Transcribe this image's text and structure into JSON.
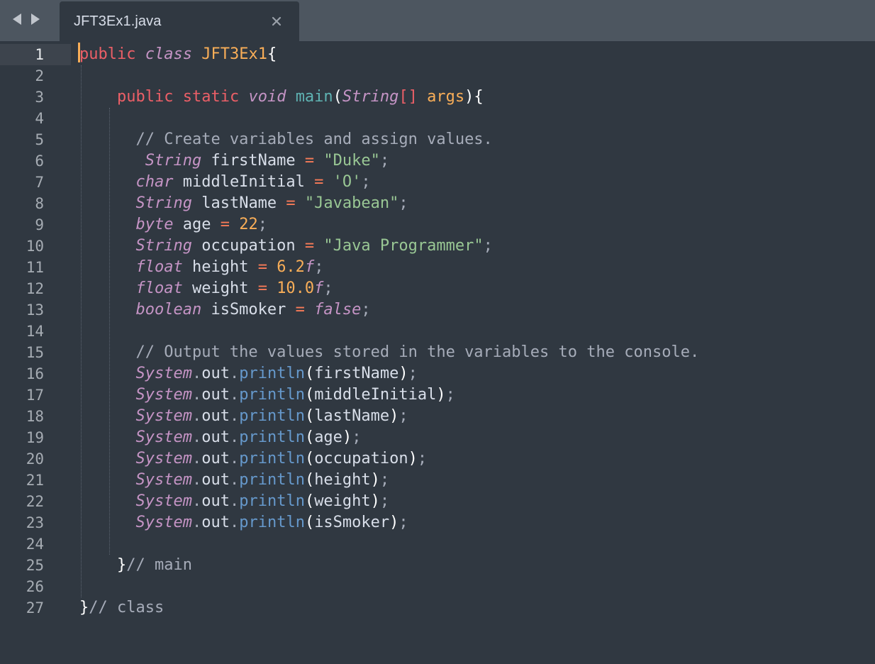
{
  "tab": {
    "title": "JFT3Ex1.java",
    "close_glyph": "×"
  },
  "nav": {
    "back_icon": "triangle-left-icon",
    "forward_icon": "triangle-right-icon"
  },
  "editor": {
    "active_line": 1,
    "line_numbers": [
      "1",
      "2",
      "3",
      "4",
      "5",
      "6",
      "7",
      "8",
      "9",
      "10",
      "11",
      "12",
      "13",
      "14",
      "15",
      "16",
      "17",
      "18",
      "19",
      "20",
      "21",
      "22",
      "23",
      "24",
      "25",
      "26",
      "27"
    ],
    "lines": [
      [
        {
          "t": "public",
          "c": "kw"
        },
        {
          "t": " ",
          "c": "pl"
        },
        {
          "t": "class",
          "c": "it"
        },
        {
          "t": " ",
          "c": "pl"
        },
        {
          "t": "JFT3Ex1",
          "c": "cls"
        },
        {
          "t": "{",
          "c": "brace"
        }
      ],
      [],
      [
        {
          "t": "    ",
          "c": "pl"
        },
        {
          "t": "public",
          "c": "kw"
        },
        {
          "t": " ",
          "c": "pl"
        },
        {
          "t": "static",
          "c": "kw"
        },
        {
          "t": " ",
          "c": "pl"
        },
        {
          "t": "void",
          "c": "it"
        },
        {
          "t": " ",
          "c": "pl"
        },
        {
          "t": "main",
          "c": "fn"
        },
        {
          "t": "(",
          "c": "brace"
        },
        {
          "t": "String",
          "c": "it"
        },
        {
          "t": "[]",
          "c": "kw"
        },
        {
          "t": " ",
          "c": "pl"
        },
        {
          "t": "args",
          "c": "param"
        },
        {
          "t": "){",
          "c": "brace"
        }
      ],
      [],
      [
        {
          "t": "      ",
          "c": "pl"
        },
        {
          "t": "// Create variables and assign values.",
          "c": "cm"
        }
      ],
      [
        {
          "t": "       ",
          "c": "pl"
        },
        {
          "t": "String",
          "c": "it"
        },
        {
          "t": " firstName ",
          "c": "pl"
        },
        {
          "t": "=",
          "c": "op"
        },
        {
          "t": " ",
          "c": "pl"
        },
        {
          "t": "\"Duke\"",
          "c": "str"
        },
        {
          "t": ";",
          "c": "punc"
        }
      ],
      [
        {
          "t": "      ",
          "c": "pl"
        },
        {
          "t": "char",
          "c": "it"
        },
        {
          "t": " middleInitial ",
          "c": "pl"
        },
        {
          "t": "=",
          "c": "op"
        },
        {
          "t": " ",
          "c": "pl"
        },
        {
          "t": "'O'",
          "c": "str"
        },
        {
          "t": ";",
          "c": "punc"
        }
      ],
      [
        {
          "t": "      ",
          "c": "pl"
        },
        {
          "t": "String",
          "c": "it"
        },
        {
          "t": " lastName ",
          "c": "pl"
        },
        {
          "t": "=",
          "c": "op"
        },
        {
          "t": " ",
          "c": "pl"
        },
        {
          "t": "\"Javabean\"",
          "c": "str"
        },
        {
          "t": ";",
          "c": "punc"
        }
      ],
      [
        {
          "t": "      ",
          "c": "pl"
        },
        {
          "t": "byte",
          "c": "it"
        },
        {
          "t": " age ",
          "c": "pl"
        },
        {
          "t": "=",
          "c": "op"
        },
        {
          "t": " ",
          "c": "pl"
        },
        {
          "t": "22",
          "c": "num-lit"
        },
        {
          "t": ";",
          "c": "punc"
        }
      ],
      [
        {
          "t": "      ",
          "c": "pl"
        },
        {
          "t": "String",
          "c": "it"
        },
        {
          "t": " occupation ",
          "c": "pl"
        },
        {
          "t": "=",
          "c": "op"
        },
        {
          "t": " ",
          "c": "pl"
        },
        {
          "t": "\"Java Programmer\"",
          "c": "str"
        },
        {
          "t": ";",
          "c": "punc"
        }
      ],
      [
        {
          "t": "      ",
          "c": "pl"
        },
        {
          "t": "float",
          "c": "it"
        },
        {
          "t": " height ",
          "c": "pl"
        },
        {
          "t": "=",
          "c": "op"
        },
        {
          "t": " ",
          "c": "pl"
        },
        {
          "t": "6.2",
          "c": "num-lit"
        },
        {
          "t": "f",
          "c": "it"
        },
        {
          "t": ";",
          "c": "punc"
        }
      ],
      [
        {
          "t": "      ",
          "c": "pl"
        },
        {
          "t": "float",
          "c": "it"
        },
        {
          "t": " weight ",
          "c": "pl"
        },
        {
          "t": "=",
          "c": "op"
        },
        {
          "t": " ",
          "c": "pl"
        },
        {
          "t": "10.0",
          "c": "num-lit"
        },
        {
          "t": "f",
          "c": "it"
        },
        {
          "t": ";",
          "c": "punc"
        }
      ],
      [
        {
          "t": "      ",
          "c": "pl"
        },
        {
          "t": "boolean",
          "c": "it"
        },
        {
          "t": " isSmoker ",
          "c": "pl"
        },
        {
          "t": "=",
          "c": "op"
        },
        {
          "t": " ",
          "c": "pl"
        },
        {
          "t": "false",
          "c": "kw it"
        },
        {
          "t": ";",
          "c": "punc"
        }
      ],
      [],
      [
        {
          "t": "      ",
          "c": "pl"
        },
        {
          "t": "// Output the values stored in the variables to the console.",
          "c": "cm"
        }
      ],
      [
        {
          "t": "      ",
          "c": "pl"
        },
        {
          "t": "System",
          "c": "it"
        },
        {
          "t": ".",
          "c": "punc"
        },
        {
          "t": "out",
          "c": "pl"
        },
        {
          "t": ".",
          "c": "punc"
        },
        {
          "t": "println",
          "c": "meth"
        },
        {
          "t": "(",
          "c": "brace"
        },
        {
          "t": "firstName",
          "c": "pl"
        },
        {
          "t": ")",
          "c": "brace"
        },
        {
          "t": ";",
          "c": "punc"
        }
      ],
      [
        {
          "t": "      ",
          "c": "pl"
        },
        {
          "t": "System",
          "c": "it"
        },
        {
          "t": ".",
          "c": "punc"
        },
        {
          "t": "out",
          "c": "pl"
        },
        {
          "t": ".",
          "c": "punc"
        },
        {
          "t": "println",
          "c": "meth"
        },
        {
          "t": "(",
          "c": "brace"
        },
        {
          "t": "middleInitial",
          "c": "pl"
        },
        {
          "t": ")",
          "c": "brace"
        },
        {
          "t": ";",
          "c": "punc"
        }
      ],
      [
        {
          "t": "      ",
          "c": "pl"
        },
        {
          "t": "System",
          "c": "it"
        },
        {
          "t": ".",
          "c": "punc"
        },
        {
          "t": "out",
          "c": "pl"
        },
        {
          "t": ".",
          "c": "punc"
        },
        {
          "t": "println",
          "c": "meth"
        },
        {
          "t": "(",
          "c": "brace"
        },
        {
          "t": "lastName",
          "c": "pl"
        },
        {
          "t": ")",
          "c": "brace"
        },
        {
          "t": ";",
          "c": "punc"
        }
      ],
      [
        {
          "t": "      ",
          "c": "pl"
        },
        {
          "t": "System",
          "c": "it"
        },
        {
          "t": ".",
          "c": "punc"
        },
        {
          "t": "out",
          "c": "pl"
        },
        {
          "t": ".",
          "c": "punc"
        },
        {
          "t": "println",
          "c": "meth"
        },
        {
          "t": "(",
          "c": "brace"
        },
        {
          "t": "age",
          "c": "pl"
        },
        {
          "t": ")",
          "c": "brace"
        },
        {
          "t": ";",
          "c": "punc"
        }
      ],
      [
        {
          "t": "      ",
          "c": "pl"
        },
        {
          "t": "System",
          "c": "it"
        },
        {
          "t": ".",
          "c": "punc"
        },
        {
          "t": "out",
          "c": "pl"
        },
        {
          "t": ".",
          "c": "punc"
        },
        {
          "t": "println",
          "c": "meth"
        },
        {
          "t": "(",
          "c": "brace"
        },
        {
          "t": "occupation",
          "c": "pl"
        },
        {
          "t": ")",
          "c": "brace"
        },
        {
          "t": ";",
          "c": "punc"
        }
      ],
      [
        {
          "t": "      ",
          "c": "pl"
        },
        {
          "t": "System",
          "c": "it"
        },
        {
          "t": ".",
          "c": "punc"
        },
        {
          "t": "out",
          "c": "pl"
        },
        {
          "t": ".",
          "c": "punc"
        },
        {
          "t": "println",
          "c": "meth"
        },
        {
          "t": "(",
          "c": "brace"
        },
        {
          "t": "height",
          "c": "pl"
        },
        {
          "t": ")",
          "c": "brace"
        },
        {
          "t": ";",
          "c": "punc"
        }
      ],
      [
        {
          "t": "      ",
          "c": "pl"
        },
        {
          "t": "System",
          "c": "it"
        },
        {
          "t": ".",
          "c": "punc"
        },
        {
          "t": "out",
          "c": "pl"
        },
        {
          "t": ".",
          "c": "punc"
        },
        {
          "t": "println",
          "c": "meth"
        },
        {
          "t": "(",
          "c": "brace"
        },
        {
          "t": "weight",
          "c": "pl"
        },
        {
          "t": ")",
          "c": "brace"
        },
        {
          "t": ";",
          "c": "punc"
        }
      ],
      [
        {
          "t": "      ",
          "c": "pl"
        },
        {
          "t": "System",
          "c": "it"
        },
        {
          "t": ".",
          "c": "punc"
        },
        {
          "t": "out",
          "c": "pl"
        },
        {
          "t": ".",
          "c": "punc"
        },
        {
          "t": "println",
          "c": "meth"
        },
        {
          "t": "(",
          "c": "brace"
        },
        {
          "t": "isSmoker",
          "c": "pl"
        },
        {
          "t": ")",
          "c": "brace"
        },
        {
          "t": ";",
          "c": "punc"
        }
      ],
      [],
      [
        {
          "t": "    ",
          "c": "pl"
        },
        {
          "t": "}",
          "c": "brace"
        },
        {
          "t": "// main",
          "c": "cm"
        }
      ],
      [],
      [
        {
          "t": "}",
          "c": "brace"
        },
        {
          "t": "// class",
          "c": "cm"
        }
      ]
    ]
  },
  "colors": {
    "background": "#303841",
    "tabbar": "#4d5660",
    "caret": "#f9ae58",
    "keyword": "#ec5f67",
    "string": "#99c794",
    "number": "#f9ae58",
    "function": "#5fb3b3",
    "method": "#6699cc",
    "type_italic": "#c594c5"
  }
}
